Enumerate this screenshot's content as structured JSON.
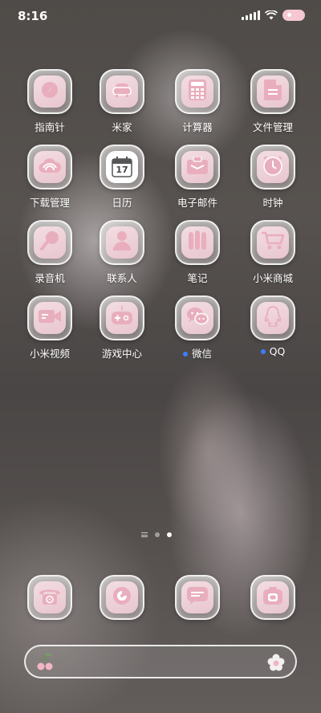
{
  "status_bar": {
    "time": "8:16",
    "signal_icon": "signal-icon",
    "wifi_icon": "wifi-icon",
    "battery_icon": "battery-icon"
  },
  "apps": [
    {
      "label": "指南针",
      "icon": "compass-icon",
      "notification_dot": false
    },
    {
      "label": "米家",
      "icon": "sofa-icon",
      "notification_dot": false
    },
    {
      "label": "计算器",
      "icon": "calculator-icon",
      "notification_dot": false
    },
    {
      "label": "文件管理",
      "icon": "file-icon",
      "notification_dot": false
    },
    {
      "label": "下载管理",
      "icon": "cloud-download-icon",
      "notification_dot": false
    },
    {
      "label": "日历",
      "icon": "calendar-icon",
      "calendar_day": "17",
      "notification_dot": false
    },
    {
      "label": "电子邮件",
      "icon": "mail-icon",
      "notification_dot": false
    },
    {
      "label": "时钟",
      "icon": "clock-icon",
      "notification_dot": false
    },
    {
      "label": "录音机",
      "icon": "microphone-icon",
      "notification_dot": false
    },
    {
      "label": "联系人",
      "icon": "contact-person-icon",
      "notification_dot": false
    },
    {
      "label": "笔记",
      "icon": "notes-bars-icon",
      "notification_dot": false
    },
    {
      "label": "小米商城",
      "icon": "shopping-cart-icon",
      "notification_dot": false
    },
    {
      "label": "小米视频",
      "icon": "video-camera-icon",
      "notification_dot": false
    },
    {
      "label": "游戏中心",
      "icon": "gamepad-icon",
      "notification_dot": false
    },
    {
      "label": "微信",
      "icon": "wechat-bubbles-icon",
      "notification_dot": true
    },
    {
      "label": "QQ",
      "icon": "qq-penguin-icon",
      "notification_dot": true
    }
  ],
  "page_indicator": {
    "pages": 2,
    "active_page": 2
  },
  "dock": [
    {
      "name": "phone",
      "icon": "phone-icon"
    },
    {
      "name": "browser",
      "icon": "browser-icon"
    },
    {
      "name": "messages",
      "icon": "message-icon"
    },
    {
      "name": "camera",
      "icon": "camera-icon"
    }
  ],
  "search_bar": {
    "left_icon": "cherry-icon",
    "right_icon": "flower-icon"
  },
  "colors": {
    "icon_pink": "#e9aebd",
    "icon_bg": "#f3dde3",
    "notification_dot": "#3d7dff"
  }
}
